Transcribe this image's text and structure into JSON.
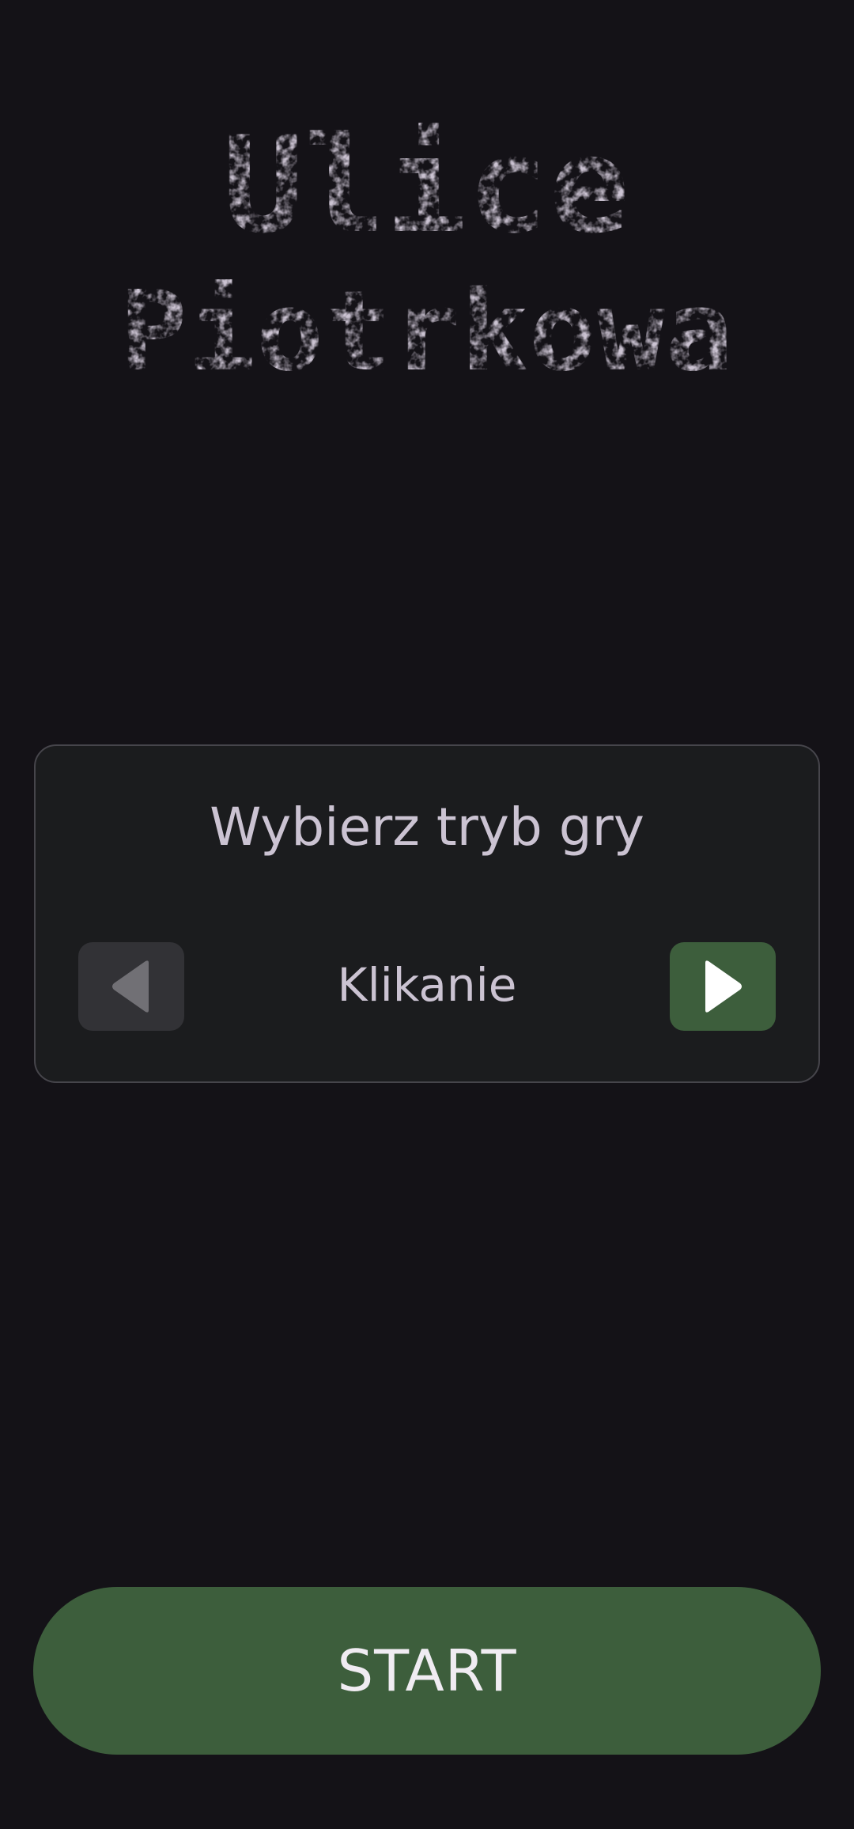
{
  "title": {
    "line1": "Ulice",
    "line2": "Piotrkowa"
  },
  "mode_selector": {
    "heading": "Wybierz tryb gry",
    "selected_mode": "Klikanie",
    "prev_icon": "triangle-left-icon",
    "next_icon": "triangle-right-icon"
  },
  "start_button": {
    "label": "START"
  },
  "colors": {
    "background": "#141217",
    "card_background": "#1b1c1e",
    "card_border": "#46454b",
    "text": "#cbc3d2",
    "accent_green": "#3d5e3c",
    "disabled_button": "#323236"
  }
}
